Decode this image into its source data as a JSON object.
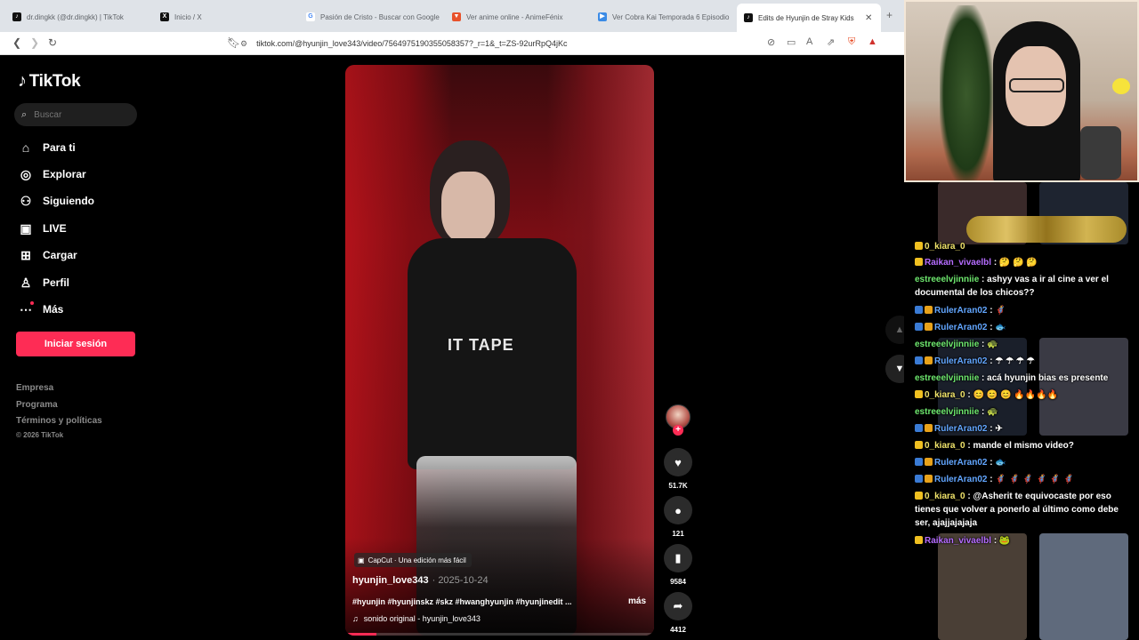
{
  "browser": {
    "tabs": [
      {
        "title": "dr.dingkk (@dr.dingkk) | TikTok",
        "fav": "tiktok-icon"
      },
      {
        "title": "Inicio / X",
        "fav": "x-icon"
      },
      {
        "title": "Pasión de Cristo - Buscar con Google",
        "fav": "google-icon"
      },
      {
        "title": "Ver anime online - AnimeFénix",
        "fav": "animefenix-icon"
      },
      {
        "title": "Ver Cobra Kai Temporada 6 Episodio",
        "fav": "play-icon"
      },
      {
        "title": "Edits de Hyunjin de Stray Kids",
        "fav": "tiktok-icon"
      }
    ],
    "url": "tiktok.com/@hyunjin_love343/video/7564975190355058357?_r=1&_t=ZS-92urRpQ4jKc"
  },
  "sidebar": {
    "logo": "TikTok",
    "search_placeholder": "Buscar",
    "nav": [
      {
        "label": "Para ti",
        "icon": "home-icon"
      },
      {
        "label": "Explorar",
        "icon": "compass-icon"
      },
      {
        "label": "Siguiendo",
        "icon": "following-icon"
      },
      {
        "label": "LIVE",
        "icon": "live-icon"
      },
      {
        "label": "Cargar",
        "icon": "upload-icon"
      },
      {
        "label": "Perfil",
        "icon": "profile-icon"
      },
      {
        "label": "Más",
        "icon": "more-icon"
      }
    ],
    "login": "Iniciar sesión",
    "footer": [
      "Empresa",
      "Programa",
      "Términos y políticas"
    ],
    "copyright": "© 2026 TikTok"
  },
  "video": {
    "shirt_text": "IT TAPE",
    "capcut": "CapCut · Una edición más fácil",
    "author": "hyunjin_love343",
    "date": "· 2025-10-24",
    "caption": "#hyunjin #hyunjinskz #skz #hwanghyunjin #hyunjinedit ...",
    "more": "más",
    "sound": "sonido original - hyunjin_love343",
    "progress": 0.1
  },
  "actions": {
    "likes": "51.7K",
    "comments": "121",
    "saves": "9584",
    "shares": "4412"
  },
  "stream_chat": {
    "messages": [
      {
        "user": "0_kiara_0",
        "text": "",
        "color": "u-yellow"
      },
      {
        "user": "Raikan_vivaelbl",
        "text": ": 🤔 🤔 🤔",
        "color": "u-purple"
      },
      {
        "user": "estreeelvjinniie",
        "text": ": ashyy vas a ir al cine a ver el documental de los chicos??",
        "color": "u-green"
      },
      {
        "user": "RulerAran02",
        "text": ": 🦸",
        "color": "u-blue"
      },
      {
        "user": "RulerAran02",
        "text": ": 🐟",
        "color": "u-blue"
      },
      {
        "user": "estreeelvjinniie",
        "text": ": 🐢",
        "color": "u-green"
      },
      {
        "user": "RulerAran02",
        "text": ": ☂ ☂ ☂ ☂",
        "color": "u-blue"
      },
      {
        "user": "estreeelvjinniie",
        "text": ": acá hyunjin bias es presente",
        "color": "u-green"
      },
      {
        "user": "0_kiara_0",
        "text": ": 😊 😊 😊 🔥🔥🔥🔥",
        "color": "u-yellow"
      },
      {
        "user": "estreeelvjinniie",
        "text": ": 🐢",
        "color": "u-green"
      },
      {
        "user": "RulerAran02",
        "text": ": ✈",
        "color": "u-blue"
      },
      {
        "user": "0_kiara_0",
        "text": ": mande el mismo video?",
        "color": "u-yellow"
      },
      {
        "user": "RulerAran02",
        "text": ": 🐟",
        "color": "u-blue"
      },
      {
        "user": "RulerAran02",
        "text": ": 🦸 🦸 🦸 🦸 🦸 🦸",
        "color": "u-blue"
      },
      {
        "user": "0_kiara_0",
        "text": ": @Asherit te equivocaste por eso tienes que volver a ponerlo al último como debe ser, ajajjajajaja",
        "color": "u-yellow"
      },
      {
        "user": "Raikan_vivaelbl",
        "text": ": 🐸",
        "color": "u-purple"
      }
    ]
  }
}
